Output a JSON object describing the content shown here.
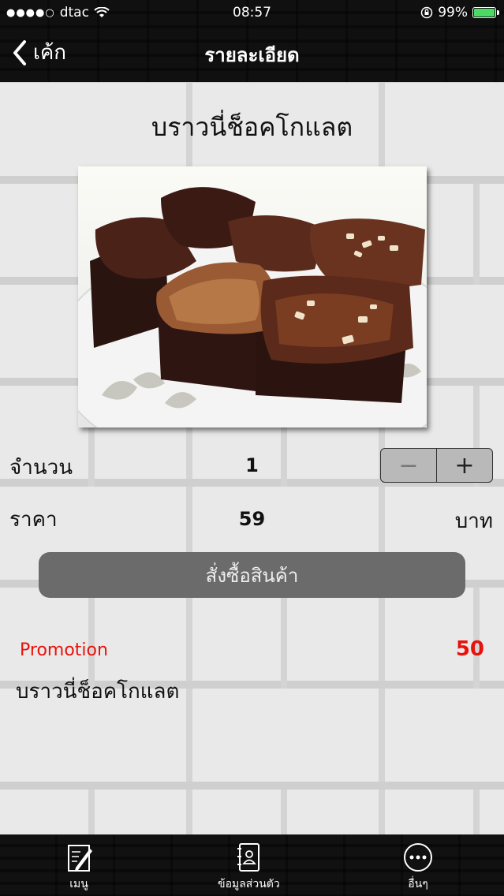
{
  "status_bar": {
    "carrier": "dtac",
    "time": "08:57",
    "battery": "99%"
  },
  "nav": {
    "back_label": "เค้ก",
    "title": "รายละเอียด"
  },
  "product": {
    "name": "บราวนี่ช็อคโกแลต",
    "quantity_label": "จำนวน",
    "quantity": "1",
    "price_label": "ราคา",
    "price": "59",
    "currency": "บาท",
    "order_button": "สั่งซื้อสินค้า"
  },
  "stepper": {
    "minus": "−",
    "plus": "+"
  },
  "promotion": {
    "label": "Promotion",
    "value": "50",
    "name": "บราวนี่ช็อคโกแลต"
  },
  "tabbar": {
    "items": [
      {
        "label": "เมนู",
        "icon": "menu-edit-icon"
      },
      {
        "label": "ข้อมูลส่วนตัว",
        "icon": "contacts-book-icon"
      },
      {
        "label": "อื่นๆ",
        "icon": "more-icon"
      }
    ]
  },
  "colors": {
    "promo": "#e8120c",
    "order_button": "#6b6b6b",
    "battery": "#4cd964"
  }
}
